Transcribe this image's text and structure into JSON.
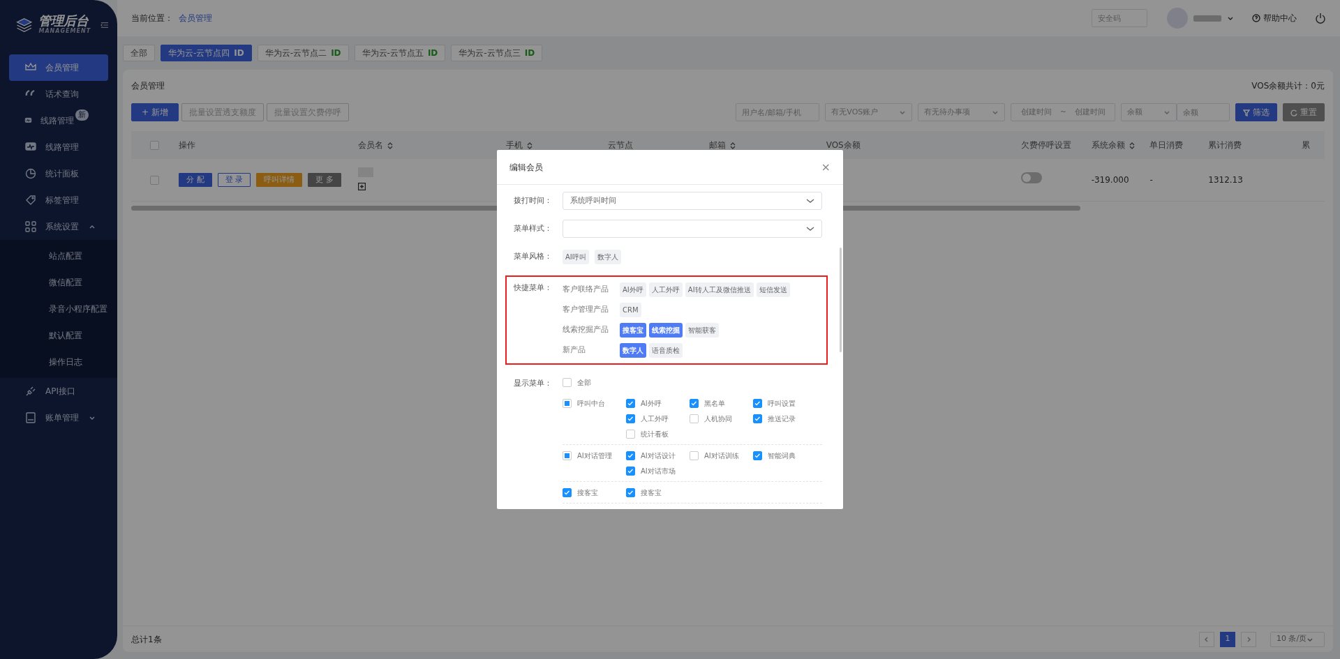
{
  "sidebar": {
    "logo_title": "管理后台",
    "logo_subtitle": "MANAGEMENT",
    "items": [
      {
        "label": "会员管理",
        "selected": true
      },
      {
        "label": "话术查询",
        "selected": false
      },
      {
        "label": "线路管理",
        "selected": false,
        "badge": "新"
      },
      {
        "label": "线路管理",
        "selected": false
      },
      {
        "label": "统计面板",
        "selected": false
      },
      {
        "label": "标签管理",
        "selected": false
      },
      {
        "label": "系统设置",
        "selected": false,
        "expanded": true,
        "children": [
          {
            "label": "站点配置",
            "selected": false
          },
          {
            "label": "微信配置",
            "selected": false
          },
          {
            "label": "录音小程序配置",
            "selected": false
          },
          {
            "label": "默认配置",
            "selected": false
          },
          {
            "label": "操作日志",
            "selected": false
          }
        ]
      },
      {
        "label": "API接口",
        "selected": false
      },
      {
        "label": "账单管理",
        "selected": false,
        "expanded": false
      }
    ]
  },
  "header": {
    "breadcrumb_label": "当前位置：",
    "breadcrumb_link": "会员管理",
    "security_code": {
      "placeholder": "安全码"
    },
    "help": "帮助中心"
  },
  "node_tabs": [
    {
      "label": "全部",
      "selected": false
    },
    {
      "label": "华为云-云节点四",
      "tag": "ID",
      "selected": true
    },
    {
      "label": "华为云-云节点二",
      "tag": "ID",
      "selected": false
    },
    {
      "label": "华为云-云节点五",
      "tag": "ID",
      "selected": false
    },
    {
      "label": "华为云-云节点三",
      "tag": "ID",
      "selected": false
    }
  ],
  "panel": {
    "title": "会员管理",
    "vos_total": "VOS余额共计：0元",
    "toolbar": [
      {
        "label": "新增",
        "icon": "+",
        "disabled": false
      },
      {
        "label": "批量设置透支额度",
        "disabled": true
      },
      {
        "label": "批量设置欠费停呼",
        "disabled": true
      }
    ],
    "filters": [
      {
        "kind": "input",
        "placeholder": "用户名/邮箱/手机"
      },
      {
        "kind": "select",
        "placeholder": "有无VOS账户"
      },
      {
        "kind": "select",
        "placeholder": "有无待办事项"
      },
      {
        "kind": "range",
        "placeholder": "创建时间",
        "separator": "~",
        "placeholder_end": "创建时间"
      },
      {
        "kind": "select",
        "placeholder": "余额"
      },
      {
        "kind": "input",
        "placeholder": "余额"
      }
    ],
    "filter_button": "筛选",
    "reset_button": "重置"
  },
  "table": {
    "all_selected": false,
    "columns": [
      {
        "label": "操作"
      },
      {
        "label": "会员名",
        "sortable": true
      },
      {
        "label": "手机",
        "sortable": true
      },
      {
        "label": "云节点"
      },
      {
        "label": "邮箱",
        "sortable": true
      },
      {
        "label": "VOS余额"
      },
      {
        "label": "欠费停呼设置"
      },
      {
        "label": "系统余额",
        "sortable": true
      },
      {
        "label": "单日消费"
      },
      {
        "label": "累计消费"
      },
      {
        "label": "累"
      }
    ],
    "rows": [
      {
        "selected": false,
        "actions": [
          {
            "label": "分 配",
            "kind": "primary"
          },
          {
            "label": "登 录",
            "kind": "outline"
          },
          {
            "label": "呼叫详情",
            "kind": "warning"
          },
          {
            "label": "更 多",
            "kind": "dark"
          }
        ],
        "arrears_stop": false,
        "system_balance": "-319.000",
        "daily": "-",
        "total": "1312.13"
      }
    ]
  },
  "footer": {
    "total": "总计1条",
    "pages": [
      {
        "label": "1",
        "selected": true
      }
    ],
    "page_size": "10 条/页"
  },
  "modal": {
    "title": "编辑会员",
    "close": "×",
    "call_time": {
      "label": "拨打时间：",
      "value": "系统呼叫时间"
    },
    "menu_style": {
      "label": "菜单样式："
    },
    "menu_theme": {
      "label": "菜单风格：",
      "options": [
        {
          "label": "AI呼叫",
          "selected": false
        },
        {
          "label": "数字人",
          "selected": false
        }
      ]
    },
    "quick_menu": {
      "label": "快捷菜单：",
      "highlighted": true,
      "groups": [
        {
          "name": "客户联络产品",
          "options": [
            {
              "label": "AI外呼",
              "selected": false
            },
            {
              "label": "人工外呼",
              "selected": false
            },
            {
              "label": "AI转人工及微信推送",
              "selected": false
            },
            {
              "label": "短信发送",
              "selected": false
            }
          ]
        },
        {
          "name": "客户管理产品",
          "options": [
            {
              "label": "CRM",
              "selected": false
            }
          ]
        },
        {
          "name": "线索挖掘产品",
          "options": [
            {
              "label": "搜客宝",
              "selected": true
            },
            {
              "label": "线索挖掘",
              "selected": true
            },
            {
              "label": "智能获客",
              "selected": false
            }
          ]
        },
        {
          "name": "新产品",
          "options": [
            {
              "label": "数字人",
              "selected": true
            },
            {
              "label": "语音质检",
              "selected": false
            }
          ]
        }
      ]
    },
    "show_menu": {
      "label": "显示菜单：",
      "all": {
        "label": "全部",
        "checked": false
      },
      "groups": [
        {
          "label": "呼叫中台",
          "checked": false,
          "indeterminate": true,
          "children": [
            {
              "label": "AI外呼",
              "checked": true
            },
            {
              "label": "黑名单",
              "checked": true
            },
            {
              "label": "呼叫设置",
              "checked": true
            },
            {
              "label": "人工外呼",
              "checked": true
            },
            {
              "label": "人机协同",
              "checked": false
            },
            {
              "label": "推送记录",
              "checked": true
            },
            {
              "label": "统计看板",
              "checked": false
            }
          ]
        },
        {
          "label": "AI对话管理",
          "checked": false,
          "indeterminate": true,
          "children": [
            {
              "label": "AI对话设计",
              "checked": true
            },
            {
              "label": "AI对话训练",
              "checked": false
            },
            {
              "label": "智能词典",
              "checked": true
            },
            {
              "label": "AI对话市场",
              "checked": true
            }
          ]
        },
        {
          "label": "搜客宝",
          "checked": true,
          "children": [
            {
              "label": "搜客宝",
              "checked": true
            }
          ]
        }
      ]
    }
  }
}
